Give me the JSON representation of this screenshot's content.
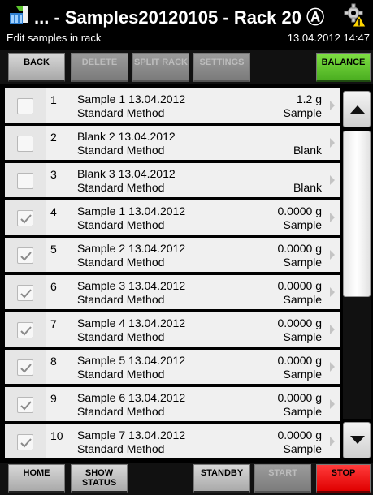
{
  "header": {
    "title": "... - Samples20120105 - Rack 20 Ⓐ",
    "subtitle": "Edit samples in rack",
    "datetime": "13.04.2012 14:47"
  },
  "toolbar": {
    "back": "BACK",
    "delete": "DELETE",
    "split_rack": "SPLIT RACK",
    "settings": "SETTINGS",
    "balance": "BALANCE"
  },
  "rows": [
    {
      "num": "1",
      "name": "Sample 1 13.04.2012",
      "method": "Standard Method",
      "amount": "1.2 g",
      "type": "Sample",
      "checked": false
    },
    {
      "num": "2",
      "name": "Blank 2 13.04.2012",
      "method": "Standard Method",
      "amount": "",
      "type": "Blank",
      "checked": false
    },
    {
      "num": "3",
      "name": "Blank 3 13.04.2012",
      "method": "Standard Method",
      "amount": "",
      "type": "Blank",
      "checked": false
    },
    {
      "num": "4",
      "name": "Sample 1 13.04.2012",
      "method": "Standard Method",
      "amount": "0.0000 g",
      "type": "Sample",
      "checked": true
    },
    {
      "num": "5",
      "name": "Sample 2 13.04.2012",
      "method": "Standard Method",
      "amount": "0.0000 g",
      "type": "Sample",
      "checked": true
    },
    {
      "num": "6",
      "name": "Sample 3 13.04.2012",
      "method": "Standard Method",
      "amount": "0.0000 g",
      "type": "Sample",
      "checked": true
    },
    {
      "num": "7",
      "name": "Sample 4 13.04.2012",
      "method": "Standard Method",
      "amount": "0.0000 g",
      "type": "Sample",
      "checked": true
    },
    {
      "num": "8",
      "name": "Sample 5 13.04.2012",
      "method": "Standard Method",
      "amount": "0.0000 g",
      "type": "Sample",
      "checked": true
    },
    {
      "num": "9",
      "name": "Sample 6 13.04.2012",
      "method": "Standard Method",
      "amount": "0.0000 g",
      "type": "Sample",
      "checked": true
    },
    {
      "num": "10",
      "name": "Sample 7 13.04.2012",
      "method": "Standard Method",
      "amount": "0.0000 g",
      "type": "Sample",
      "checked": true
    }
  ],
  "bottombar": {
    "home": "HOME",
    "show_status": "SHOW STATUS",
    "standby": "STANDBY",
    "start": "START",
    "stop": "STOP"
  },
  "colors": {
    "balance_button": "#5cc42c",
    "stop_button": "#f01a1a",
    "background": "#000000",
    "row_background": "#f0f0f0"
  },
  "icons": {
    "app": "rack-icon",
    "settings": "gear-warning-icon",
    "scroll_up": "triangle-up-icon",
    "scroll_down": "triangle-down-icon",
    "row_chevron": "chevron-right-icon",
    "checkbox": "check-icon"
  }
}
